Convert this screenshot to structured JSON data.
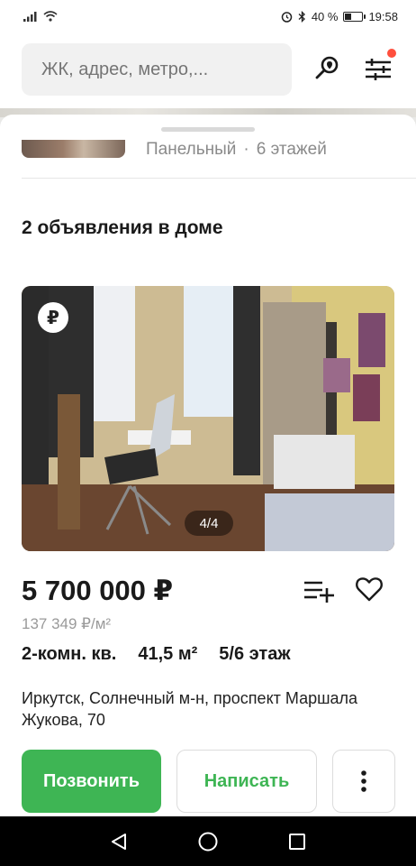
{
  "status_bar": {
    "battery_percent": "40 %",
    "time": "19:58",
    "battery_level": 0.4,
    "icons": [
      "signal-icon",
      "wifi-icon",
      "alarm-icon",
      "bluetooth-icon",
      "battery-icon"
    ]
  },
  "search": {
    "placeholder": "ЖК, адрес, метро,..."
  },
  "header": {
    "map_search_icon": "map-search-icon",
    "filter_icon": "filter-icon",
    "filter_dot_color": "#ff4f3d"
  },
  "house": {
    "type": "Панельный",
    "separator": "·",
    "floors": "6 этажей"
  },
  "listings": {
    "title": "2 объявления в доме"
  },
  "listing": {
    "photo_counter": "4/4",
    "currency_badge": "₽",
    "price": "5 700 000 ₽",
    "price_per_m2": "137 349 ₽/м²",
    "rooms": "2-комн. кв.",
    "area": "41,5 м²",
    "floor": "5/6 этаж",
    "address": "Иркутск, Солнечный м-н, проспект Маршала Жукова, 70"
  },
  "actions": {
    "call_label": "Позвонить",
    "message_label": "Написать",
    "more_icon": "more-vertical-icon"
  },
  "colors": {
    "accent_green": "#3eb554",
    "muted_text": "#8a8a8a"
  },
  "navigation": {
    "icons": [
      "back-icon",
      "home-icon",
      "recents-icon"
    ]
  }
}
